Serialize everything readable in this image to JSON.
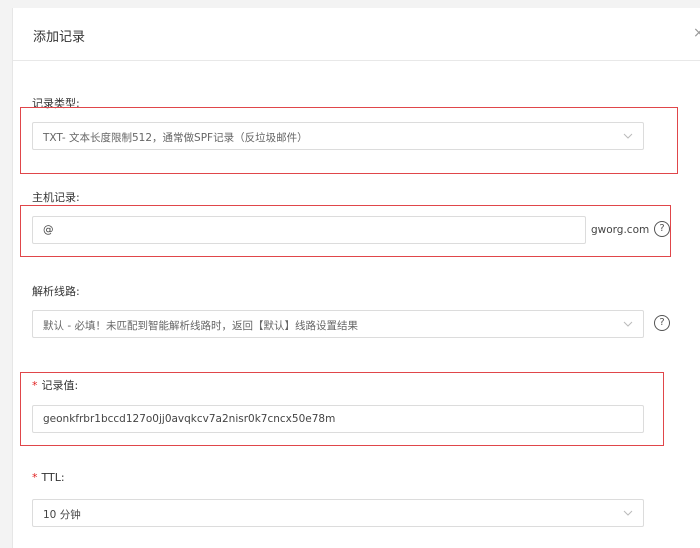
{
  "dialog": {
    "title": "添加记录",
    "close_glyph": "×"
  },
  "record_type": {
    "label": "记录类型:",
    "value": "TXT- 文本长度限制512，通常做SPF记录（反垃圾邮件）"
  },
  "host_record": {
    "label": "主机记录:",
    "value": "@",
    "suffix": "gworg.com"
  },
  "line": {
    "label": "解析线路:",
    "value": "默认 - 必填！未匹配到智能解析线路时，返回【默认】线路设置结果"
  },
  "record_value": {
    "required_mark": "*",
    "label": "记录值:",
    "value": "geonkfrbr1bccd127o0jj0avqkcv7a2nisr0k7cncx50e78m"
  },
  "ttl": {
    "required_mark": "*",
    "label": "TTL:",
    "value": "10 分钟"
  },
  "help_glyph": "?",
  "colors": {
    "highlight": "#e0464a",
    "required": "#e02020",
    "border": "#dcdcdc"
  },
  "icons": [
    "close-icon",
    "chevron-down-icon",
    "help-icon"
  ]
}
